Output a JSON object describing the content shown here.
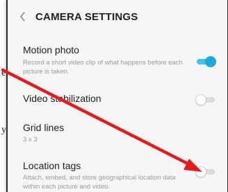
{
  "backdrop": {
    "left_text_1": "e",
    "left_text_2": "y"
  },
  "header": {
    "title": "CAMERA SETTINGS",
    "back_icon": "chevron-left-icon"
  },
  "settings": [
    {
      "title": "Motion photo",
      "subtitle": "Record a short video clip of what happens before each picture is taken.",
      "enabled": true
    },
    {
      "title": "Video stabilization",
      "subtitle": "",
      "enabled": false
    },
    {
      "title": "Grid lines",
      "subtitle": "3 x 3"
    },
    {
      "title": "Location tags",
      "subtitle": "Attach, embed, and store geographical location data within each picture and video.",
      "enabled": false
    }
  ],
  "colors": {
    "accent": "#15a9df",
    "annotation_arrow": "#e8191c"
  }
}
